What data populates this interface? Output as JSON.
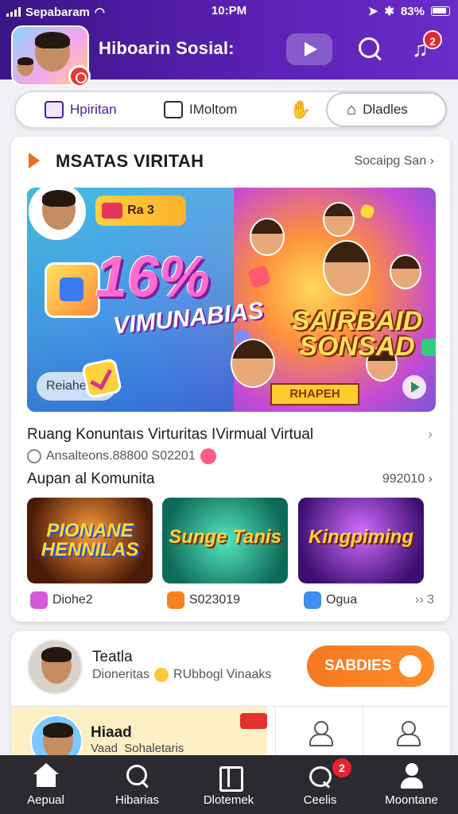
{
  "status_bar": {
    "carrier": "Sepabaram",
    "time": "10:PM",
    "battery": "83%"
  },
  "header": {
    "title": "Hiboarin Sosial:",
    "notification_count": "2"
  },
  "tabs": [
    {
      "label": "Hpiritan",
      "icon": "grid-icon",
      "active": true
    },
    {
      "label": "IMoltom",
      "icon": "monitor-icon",
      "active": false
    },
    {
      "label": "",
      "icon": "handshake-icon",
      "active": false
    },
    {
      "label": "Dladles",
      "icon": "bell-icon",
      "active": false
    }
  ],
  "section": {
    "title": "MSATAS VIRITAH",
    "link": "Socaipg San"
  },
  "banner": {
    "pill": "Ra 3",
    "big_text": "16%",
    "big_subtext": "VIMUNABIAS",
    "logo": "SAIRBAID SONSAD",
    "badge": "RHAPEH",
    "cta": "Reiahe"
  },
  "post": {
    "title": "Ruang Konuntaıs Virturitas IVirmual Virtual",
    "meta": "Ansalteons.88800 S02201"
  },
  "subsection": {
    "title": "Aupan al Komunita",
    "count": "992010"
  },
  "tiles": [
    {
      "title": "PIONANE HENNILAS",
      "meta": "Diohe2"
    },
    {
      "title": "Sunge Tanis",
      "meta": "S023019"
    },
    {
      "title": "Kingpiming",
      "meta": "Ogua"
    }
  ],
  "tiles_more": "›› 3",
  "community": {
    "name": "Teatla",
    "sub_a": "Dioneritas",
    "sub_b": "RUbbogl Vinaaks",
    "button": "SABDIES"
  },
  "feature": {
    "title": "Hiaad",
    "sub_a": "Vaad",
    "sub_b": "Sohaletaris"
  },
  "bottom_nav": [
    {
      "label": "Aepual",
      "icon": "home-icon"
    },
    {
      "label": "Hibarias",
      "icon": "search-icon"
    },
    {
      "label": "Dlotemek",
      "icon": "box-icon"
    },
    {
      "label": "Ceelis",
      "icon": "chat-icon",
      "badge": "2"
    },
    {
      "label": "Moontane",
      "icon": "user-icon"
    }
  ],
  "colors": {
    "brand_purple": "#4b1aa0",
    "accent_orange": "#f7781f",
    "badge_red": "#e6232e"
  }
}
